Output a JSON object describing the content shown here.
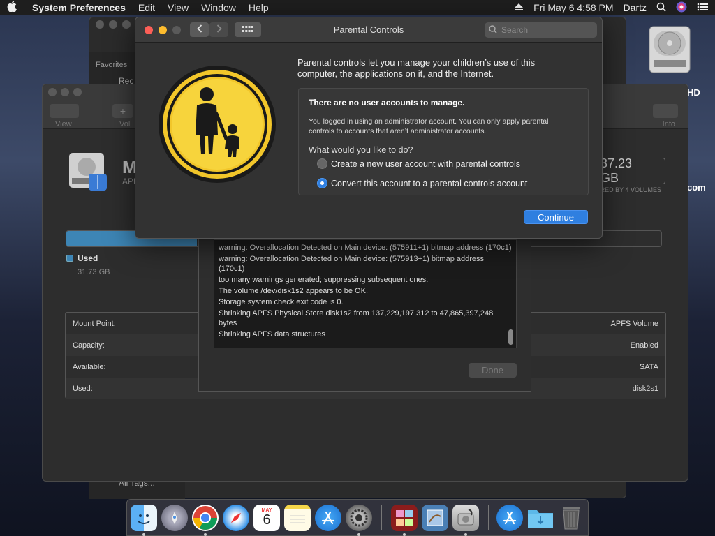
{
  "menubar": {
    "app": "System Preferences",
    "items": [
      "Edit",
      "View",
      "Window",
      "Help"
    ],
    "datetime": "Fri May 6  4:58 PM",
    "user": "Dartz"
  },
  "desktop": {
    "hd_label": "HD",
    "com_label": "com"
  },
  "finder": {
    "favorites": "Favorites",
    "recents": "Rec",
    "all_tags": "All Tags..."
  },
  "disk_utility": {
    "view_label": "View",
    "vol_label": "Vol",
    "info_label": "Info",
    "name": "M",
    "subtitle": "APF",
    "size": "37.23 GB",
    "shared": "SHARED BY 4 VOLUMES",
    "used_label": "Used",
    "used_value": "31.73 GB",
    "used_fraction": 0.22,
    "rows": [
      {
        "left": "Mount Point:",
        "right": "APFS Volume"
      },
      {
        "left": "Capacity:",
        "right": "Enabled"
      },
      {
        "left": "Available:",
        "right": "SATA"
      },
      {
        "left": "Used:",
        "right": "disk2s1"
      }
    ]
  },
  "log": {
    "lines": [
      "warning: Overallocation Detected on Main device: (575911+1) bitmap address (170c1)",
      "warning: Overallocation Detected on Main device: (575913+1) bitmap address (170c1)",
      "too many warnings generated; suppressing subsequent ones.",
      "The volume /dev/disk1s2 appears to be OK.",
      "Storage system check exit code is 0.",
      "Shrinking APFS Physical Store disk1s2 from 137,229,197,312 to 47,865,397,248 bytes",
      "Shrinking APFS data structures"
    ],
    "done_label": "Done"
  },
  "parental": {
    "title": "Parental Controls",
    "search_placeholder": "Search",
    "intro": "Parental controls let you manage your children’s use of this computer, the applications on it, and the Internet.",
    "box_title": "There are no user accounts to manage.",
    "box_desc": "You logged in using an administrator account. You can only apply parental controls to accounts that aren’t administrator accounts.",
    "question": "What would you like to do?",
    "option1": "Create a new user account with parental controls",
    "option2": "Convert this account to a parental controls account",
    "selected": "option2",
    "continue_label": "Continue"
  },
  "dock": {
    "items": [
      "finder-icon",
      "launchpad-icon",
      "chrome-icon",
      "safari-icon",
      "calendar-icon",
      "notes-icon",
      "app-store-icon",
      "system-preferences-icon",
      "photo-booth-icon",
      "preview-icon",
      "disk-utility-icon",
      "downloads-app-store-icon",
      "folder-icon",
      "trash-icon"
    ],
    "calendar_month": "MAY",
    "calendar_day": "6"
  }
}
